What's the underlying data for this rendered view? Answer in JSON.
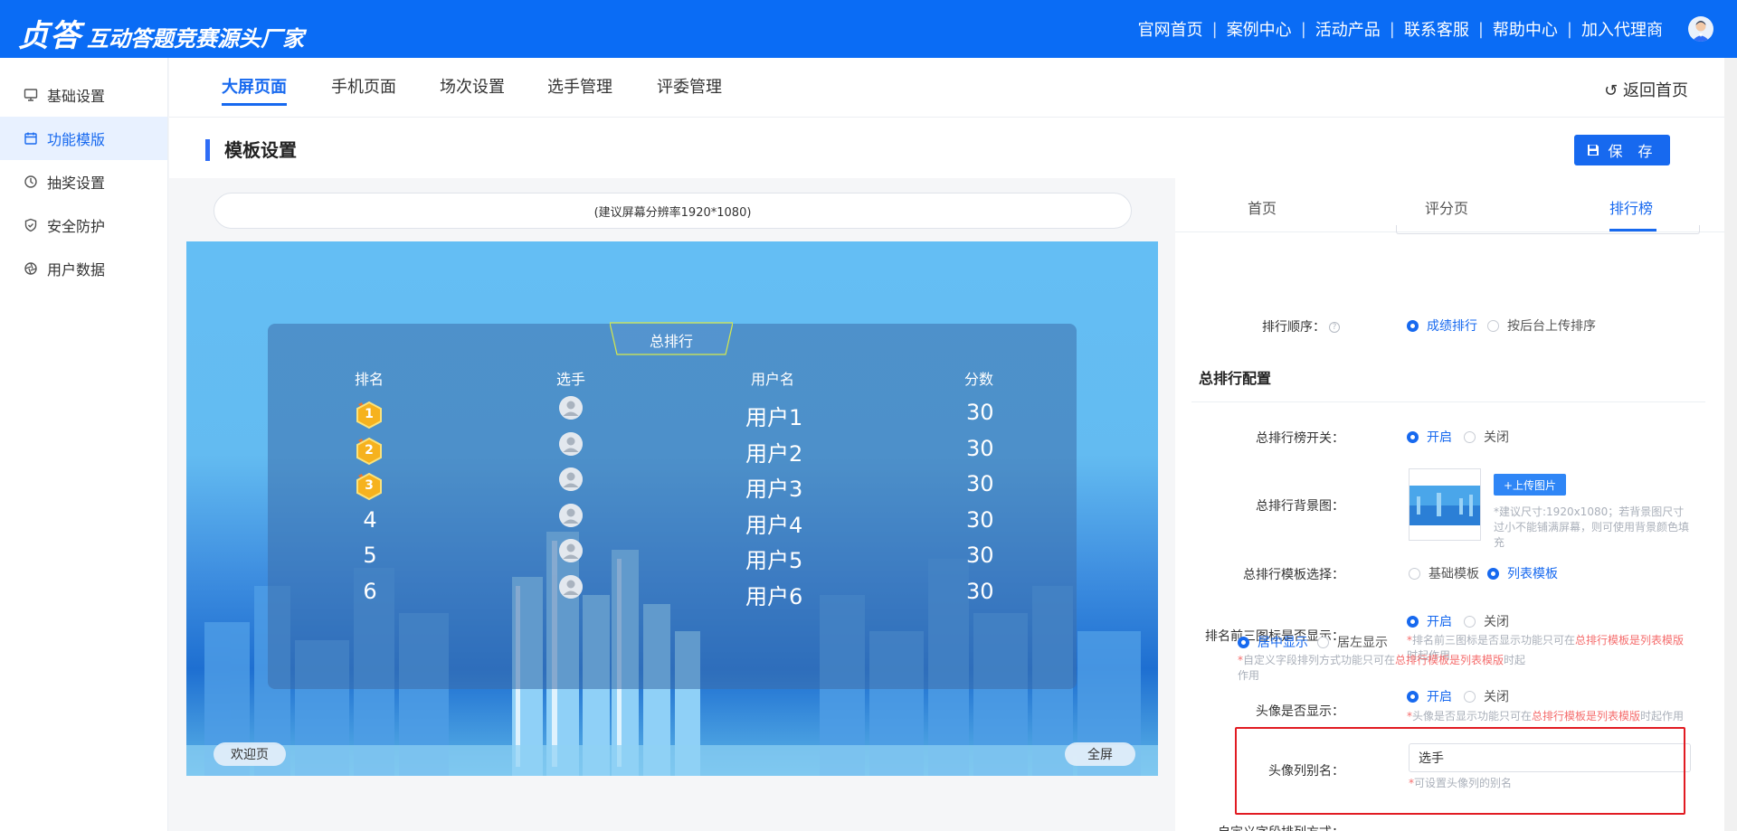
{
  "header": {
    "brand_big": "贞答",
    "brand_small": "互动答题竞赛源头厂家",
    "nav": [
      "官网首页",
      "案例中心",
      "活动产品",
      "联系客服",
      "帮助中心",
      "加入代理商"
    ]
  },
  "sidebar": {
    "items": [
      {
        "label": "基础设置",
        "icon": "monitor-icon"
      },
      {
        "label": "功能模版",
        "icon": "calendar-icon"
      },
      {
        "label": "抽奖设置",
        "icon": "dial-icon"
      },
      {
        "label": "安全防护",
        "icon": "shield-icon"
      },
      {
        "label": "用户数据",
        "icon": "aperture-icon"
      }
    ],
    "active_index": 1
  },
  "tabs": {
    "items": [
      "大屏页面",
      "手机页面",
      "场次设置",
      "选手管理",
      "评委管理"
    ],
    "active_index": 0,
    "back_label": "返回首页"
  },
  "section": {
    "title": "模板设置",
    "save_label": "保 存"
  },
  "preview": {
    "resolution_hint": "(建议屏幕分辨率1920*1080)",
    "panel_title": "总排行",
    "columns": [
      "排名",
      "选手",
      "用户名",
      "分数"
    ],
    "rows": [
      {
        "rank": "1",
        "name": "用户1",
        "score": "30",
        "medal": true
      },
      {
        "rank": "2",
        "name": "用户2",
        "score": "30",
        "medal": true
      },
      {
        "rank": "3",
        "name": "用户3",
        "score": "30",
        "medal": true
      },
      {
        "rank": "4",
        "name": "用户4",
        "score": "30",
        "medal": false
      },
      {
        "rank": "5",
        "name": "用户5",
        "score": "30",
        "medal": false
      },
      {
        "rank": "6",
        "name": "用户6",
        "score": "30",
        "medal": false
      }
    ],
    "welcome_label": "欢迎页",
    "fullscreen_label": "全屏"
  },
  "settings": {
    "tabs": [
      "首页",
      "评分页",
      "排行榜"
    ],
    "active_tab": 2,
    "rank_order": {
      "label": "排行顺序：",
      "options": [
        "成绩排行",
        "按后台上传排序"
      ],
      "selected": 0
    },
    "group_title": "总排行配置",
    "total_switch": {
      "label": "总排行榜开关：",
      "options": [
        "开启",
        "关闭"
      ],
      "selected": 0
    },
    "bg_image": {
      "label": "总排行背景图：",
      "upload_label": "+上传图片",
      "hint": "*建议尺寸:1920x1080；若背景图尺寸过小不能铺满屏幕，则可使用背景颜色填充"
    },
    "template_select": {
      "label": "总排行模板选择：",
      "options": [
        "基础模板",
        "列表模板"
      ],
      "selected": 1
    },
    "top3_icon": {
      "label": "排名前三图标是否显示：",
      "options": [
        "开启",
        "关闭"
      ],
      "selected": 0,
      "hint_a": "排名前三图标是否显示功能只可在",
      "hint_b": "总排行模板是列表模版",
      "hint_c": "时起作用"
    },
    "avatar_show": {
      "label": "头像是否显示：",
      "options": [
        "开启",
        "关闭"
      ],
      "selected": 0,
      "hint_a": "头像是否显示功能只可在",
      "hint_b": "总排行模板是列表模版",
      "hint_c": "时起作用"
    },
    "avatar_alias": {
      "label": "头像列别名：",
      "value": "选手",
      "hint": "可设置头像列的别名"
    },
    "field_align": {
      "label": "自定义字段排列方式：",
      "options": [
        "居中显示",
        "居左显示"
      ],
      "selected": 0,
      "hint_a": "自定义字段排列方式功能只可在",
      "hint_b": "总排行模板是列表模版",
      "hint_c": "时起作用"
    }
  },
  "colors": {
    "primary": "#1769ef",
    "header": "#0a6cf5",
    "highlight": "#e11b22",
    "warn": "#f56c6c"
  }
}
